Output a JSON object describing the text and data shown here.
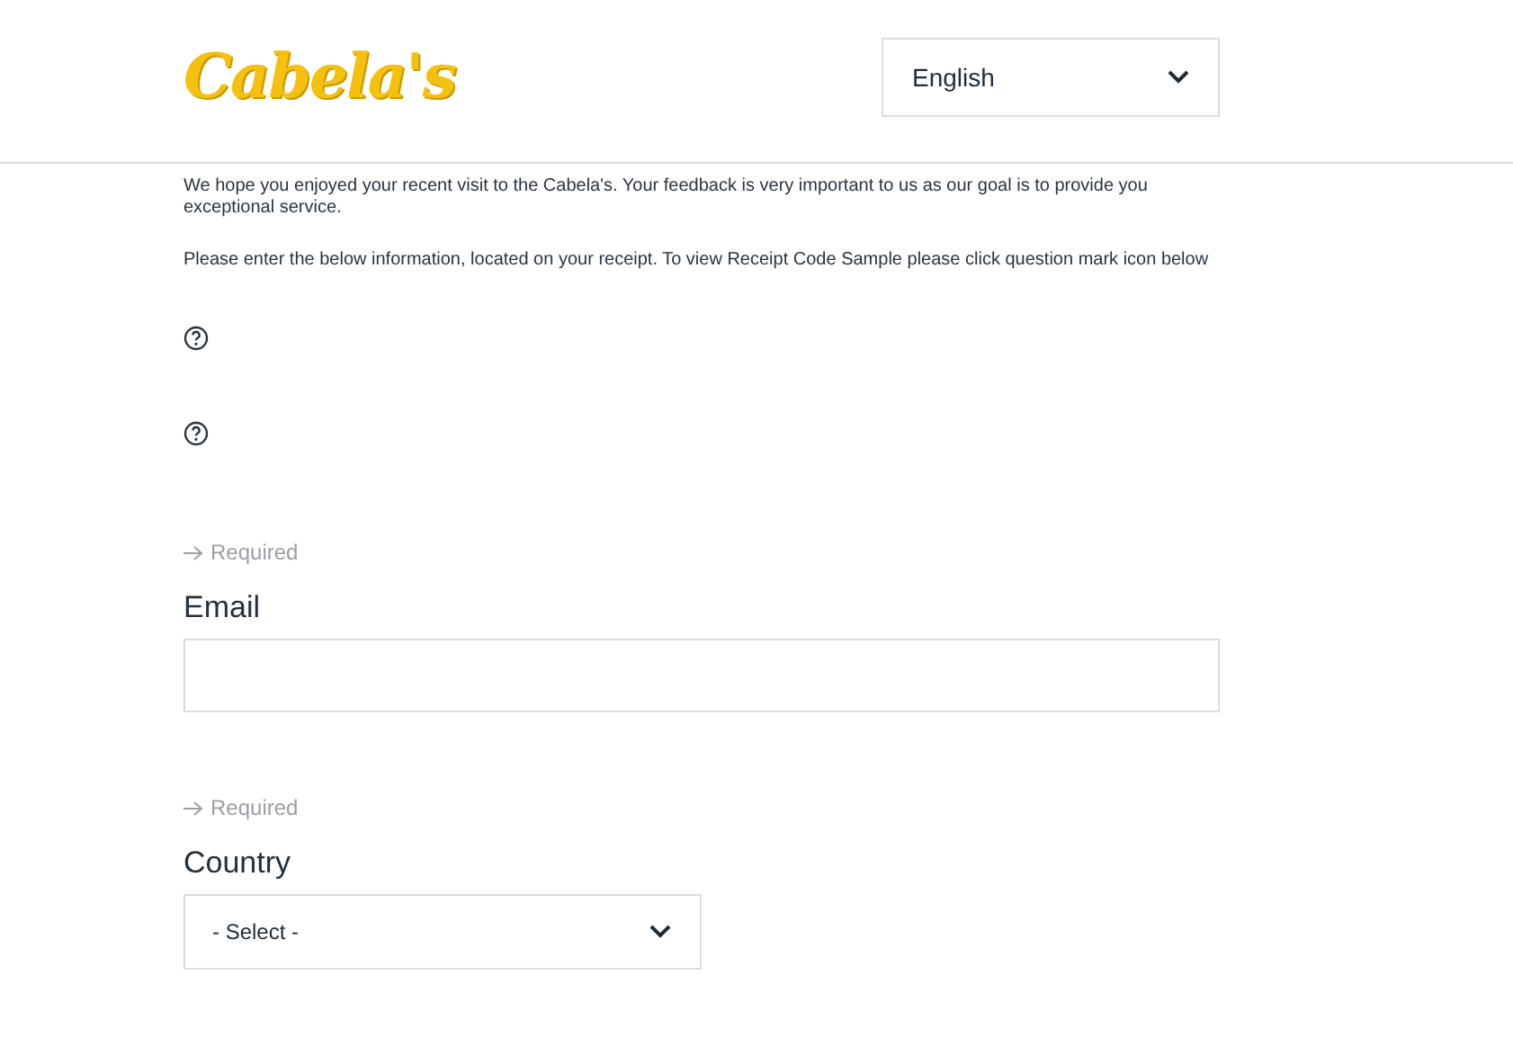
{
  "header": {
    "logo": "Cabela's",
    "language": {
      "value": "English"
    }
  },
  "intro": [
    "We hope you enjoyed your recent visit to the Cabela's. Your feedback is very important to us as our goal is to provide you exceptional service.",
    "Please enter the below information, located on your receipt. To view Receipt Code Sample please click question mark icon below"
  ],
  "receipt_fields": [
    {
      "kind": "help"
    },
    {
      "kind": "help"
    }
  ],
  "fields": [
    {
      "kind": "text",
      "required_note": "Required",
      "label": "Email"
    },
    {
      "kind": "select",
      "required_note": "Required",
      "label": "Country",
      "value": "- Select -"
    }
  ]
}
